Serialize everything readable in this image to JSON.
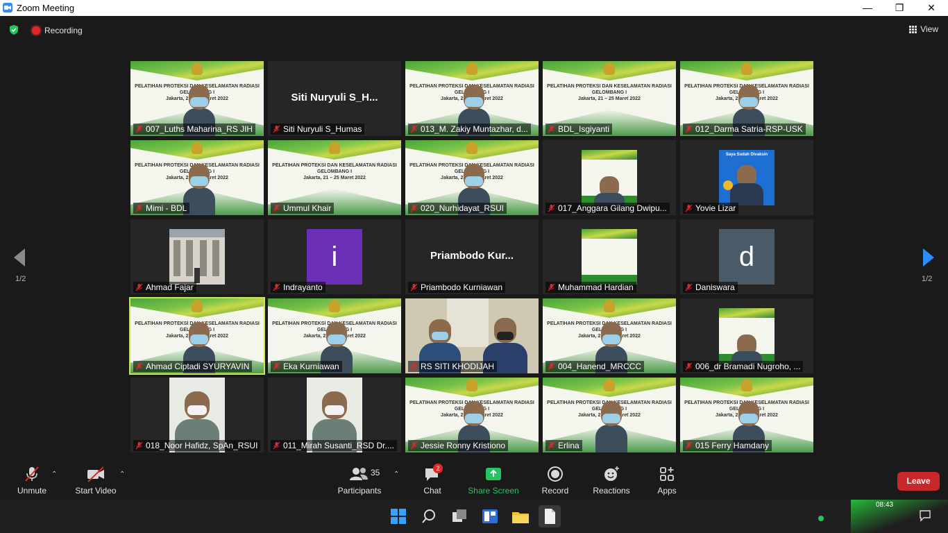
{
  "window": {
    "title": "Zoom Meeting",
    "minimize": "—",
    "restore": "❐",
    "close": "✕"
  },
  "topbar": {
    "recording": "Recording",
    "view": "View"
  },
  "pager": {
    "left": "1/2",
    "right": "1/2"
  },
  "banner_text": [
    "PELATIHAN PROTEKSI DAN KESELAMATAN RADIASI",
    "GELOMBANG I",
    "Jakarta, 21 – 25 Maret 2022"
  ],
  "tiles": [
    {
      "name": "007_Luths Maharina_RS JIH",
      "kind": "banner"
    },
    {
      "name": "Siti Nuryuli S_Humas",
      "kind": "text",
      "label": "Siti  Nuryuli  S_H..."
    },
    {
      "name": "013_M. Zakiy Muntazhar, d...",
      "kind": "banner"
    },
    {
      "name": "BDL_Isgiyanti",
      "kind": "banner-empty"
    },
    {
      "name": "012_Darma Satria-RSP-USK",
      "kind": "banner"
    },
    {
      "name": "Mimi - BDL",
      "kind": "banner"
    },
    {
      "name": "Ummul Khair",
      "kind": "banner-empty"
    },
    {
      "name": "020_Nurhidayat_RSUI",
      "kind": "banner"
    },
    {
      "name": "017_Anggara Gilang Dwipu...",
      "kind": "small-banner"
    },
    {
      "name": "Yovie Lizar",
      "kind": "poster",
      "poster": "Saya Sudah Divaksin"
    },
    {
      "name": "Ahmad Fajar",
      "kind": "building"
    },
    {
      "name": "Indrayanto",
      "kind": "avatar",
      "letter": "i",
      "color": "#6a2fb5"
    },
    {
      "name": "Priambodo Kurniawan",
      "kind": "text",
      "label": "Priambodo  Kur..."
    },
    {
      "name": "Muhammad Hardian",
      "kind": "small-banner-empty"
    },
    {
      "name": "Daniswara",
      "kind": "avatar",
      "letter": "d",
      "color": "#4a5a66"
    },
    {
      "name": "Ahmad Ciptadi SYURYAVIN",
      "kind": "banner",
      "active": true
    },
    {
      "name": "Eka Kurniawan",
      "kind": "banner"
    },
    {
      "name": "RS SITI KHODIJAH",
      "kind": "room"
    },
    {
      "name": "004_Hanend_MRCCC",
      "kind": "banner"
    },
    {
      "name": "006_dr Bramadi Nugroho, ...",
      "kind": "small-banner"
    },
    {
      "name": "018_Noor Hafidz, SpAn_RSUI",
      "kind": "small-photo"
    },
    {
      "name": "011_Mirah Susanti_RSD Dr....",
      "kind": "small-photo"
    },
    {
      "name": "Jessie Ronny Kristiono",
      "kind": "banner"
    },
    {
      "name": "Erlina",
      "kind": "banner"
    },
    {
      "name": "015 Ferry Hamdany",
      "kind": "banner"
    }
  ],
  "toolbar": {
    "unmute": "Unmute",
    "start_video": "Start Video",
    "participants": "Participants",
    "participants_count": "35",
    "chat": "Chat",
    "chat_badge": "2",
    "share_screen": "Share Screen",
    "record": "Record",
    "reactions": "Reactions",
    "apps": "Apps",
    "leave": "Leave"
  },
  "taskbar": {
    "time": "08:43"
  },
  "colors": {
    "accent_green": "#23c55e",
    "leave_red": "#c8272b",
    "active_border": "#c9e65a",
    "blue_arrow": "#2d8cff"
  }
}
